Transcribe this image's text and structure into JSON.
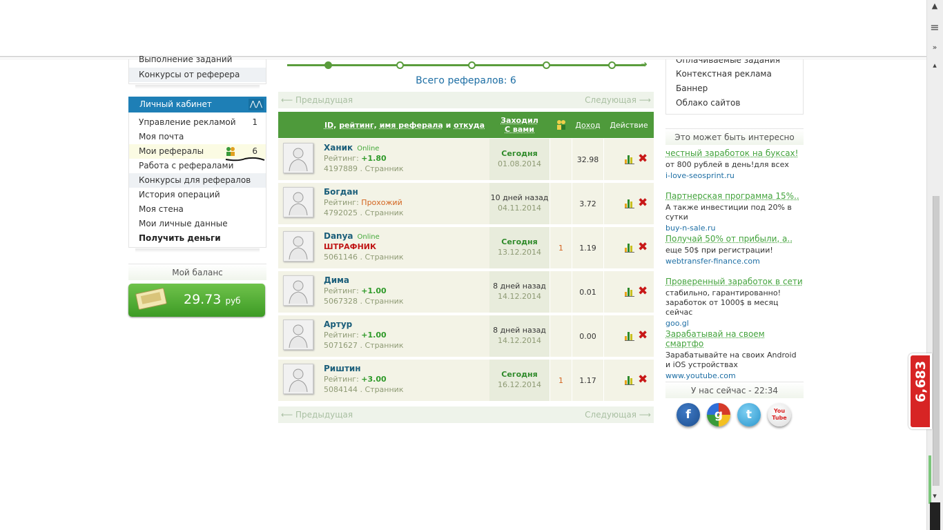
{
  "left_menu_top": {
    "items": [
      "Выполнение заданий",
      "Конкурсы от реферера"
    ]
  },
  "cabinet": {
    "title": "Личный кабинет",
    "collapse_icon": "chevron-up-icon",
    "items": [
      {
        "label": "Управление рекламой",
        "count": "1"
      },
      {
        "label": "Моя почта",
        "count": ""
      },
      {
        "label": "Мои рефералы",
        "count": "6"
      },
      {
        "label": "Работа с рефералами",
        "count": ""
      },
      {
        "label": "Конкурсы для рефералов",
        "count": ""
      },
      {
        "label": "История операций",
        "count": ""
      },
      {
        "label": "Моя стена",
        "count": ""
      },
      {
        "label": "Мои личные данные",
        "count": ""
      },
      {
        "label": "Получить деньги",
        "count": ""
      }
    ]
  },
  "balance": {
    "title": "Мой баланс",
    "value": "29.73",
    "currency": "руб",
    "icon": "money-icon"
  },
  "referrals": {
    "total_label": "Всего рефералов: 6",
    "pager": {
      "prev": "⟵ Предыдущая",
      "next": "Следующая ⟶"
    },
    "columns": {
      "id": "ID",
      "rating": "рейтинг",
      "name": "имя реферала",
      "and": "и",
      "source": "откуда",
      "visited_line1": "Заходил",
      "visited_line2": "С вами",
      "income": "Доход",
      "action": "Действие"
    },
    "rows": [
      {
        "name": "Ханик",
        "online": "Online",
        "rating_label": "Рейтинг:",
        "rating": "+1.80",
        "id_line": "4197889 . Странник",
        "when": "Сегодня",
        "date": "01.08.2014",
        "refs": "",
        "income": "32.98"
      },
      {
        "name": "Богдан",
        "online": "",
        "rating_label": "Рейтинг:",
        "rating": "Прохожий",
        "id_line": "4792025 . Странник",
        "when": "10 дней назад",
        "date": "04.11.2014",
        "refs": "",
        "income": "3.72"
      },
      {
        "name": "Danya",
        "online": "Online",
        "rating_label": "",
        "rating": "ШТРАФНИК",
        "id_line": "5061146 . Странник",
        "when": "Сегодня",
        "date": "13.12.2014",
        "refs": "1",
        "income": "1.19"
      },
      {
        "name": "Дима",
        "online": "",
        "rating_label": "Рейтинг:",
        "rating": "+1.00",
        "id_line": "5067328 . Странник",
        "when": "8 дней назад",
        "date": "14.12.2014",
        "refs": "",
        "income": "0.01"
      },
      {
        "name": "Артур",
        "online": "",
        "rating_label": "Рейтинг:",
        "rating": "+1.00",
        "id_line": "5071627 . Странник",
        "when": "8 дней назад",
        "date": "14.12.2014",
        "refs": "",
        "income": "0.00"
      },
      {
        "name": "Риштин",
        "online": "",
        "rating_label": "Рейтинг:",
        "rating": "+3.00",
        "id_line": "5084144 . Странник",
        "when": "Сегодня",
        "date": "16.12.2014",
        "refs": "1",
        "income": "1.17"
      }
    ]
  },
  "right_menu": {
    "items": [
      "Оплачиваемые задания",
      "Контекстная реклама",
      "Баннер",
      "Облако сайтов"
    ]
  },
  "interest": {
    "title": "Это может быть интересно",
    "ads": [
      {
        "title": "честный заработок на буксах!",
        "desc": "от 800 рублей в день!для всех",
        "url": "i-love-seosprint.ru"
      },
      {
        "title": "Партнерская программа 15%..",
        "desc": "А также инвестиции под 20% в сутки",
        "url": "buy-n-sale.ru"
      },
      {
        "title": "Получай 50% от прибыли, а..",
        "desc": "еще 50$ при регистрации!",
        "url": "webtransfer-finance.com"
      },
      {
        "title": "Проверенный заработок в сети",
        "desc": "стабильно, гарантированно! заработок от 1000$ в месяц сейчас",
        "url": "goo.gl"
      },
      {
        "title": "Зарабатывай на своем смартфо",
        "desc": "Зарабатывайте на своих Android и iOS устройствах",
        "url": "www.youtube.com"
      }
    ]
  },
  "now": {
    "title": "У нас сейчас - 22:34"
  },
  "social": [
    {
      "icon": "facebook-icon",
      "glyph": "f",
      "color": "#1d4f8f"
    },
    {
      "icon": "google-icon",
      "glyph": "g",
      "color": "#3a9a3a"
    },
    {
      "icon": "twitter-icon",
      "glyph": "t",
      "color": "#3aa6dc"
    },
    {
      "icon": "youtube-icon",
      "glyph": "You Tube",
      "color": "#d82020"
    }
  ],
  "counter": {
    "value": "6,683"
  }
}
